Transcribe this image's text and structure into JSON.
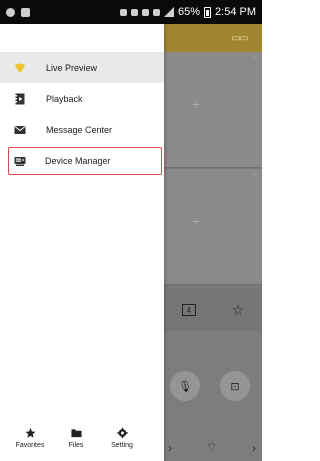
{
  "status_bar": {
    "battery": "65%",
    "time": "2:54 PM"
  },
  "nav": {
    "items": [
      {
        "label": "Live Preview",
        "icon": "live-preview-icon",
        "active": true
      },
      {
        "label": "Playback",
        "icon": "playback-icon",
        "active": false
      },
      {
        "label": "Message Center",
        "icon": "message-envelope-icon",
        "active": false
      },
      {
        "label": "Device Manager",
        "icon": "device-manager-icon",
        "active": false,
        "highlighted": true
      }
    ]
  },
  "footer_tabs": [
    {
      "label": "Favorites",
      "icon": "star-icon"
    },
    {
      "label": "Files",
      "icon": "folder-icon"
    },
    {
      "label": "Setting",
      "icon": "gear-icon"
    }
  ],
  "background": {
    "window_split_label": "4"
  },
  "colors": {
    "header_accent": "#a08530",
    "live_preview_icon": "#f2c12e",
    "highlight_border": "#d84a4a"
  }
}
